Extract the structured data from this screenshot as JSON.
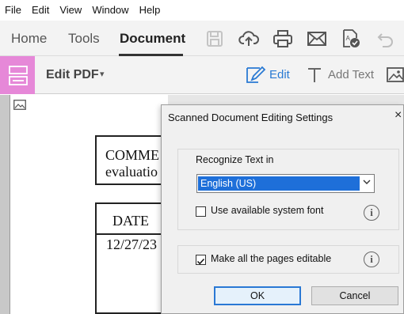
{
  "menubar": {
    "items": [
      "File",
      "Edit",
      "View",
      "Window",
      "Help"
    ]
  },
  "tabs": {
    "home": "Home",
    "tools": "Tools",
    "document": "Document"
  },
  "toolbar_icons": [
    "save-icon",
    "upload-cloud-icon",
    "print-icon",
    "mail-icon",
    "fill-sign-icon",
    "undo-icon"
  ],
  "edit_toolbar": {
    "title": "Edit PDF",
    "caret": "▾",
    "edit_label": "Edit",
    "add_text_label": "Add Text",
    "accent_color": "#e688d8",
    "link_color": "#2a7ad3"
  },
  "document": {
    "comment_line1": "COMME",
    "comment_line2": "evaluatio",
    "date_header": "DATE",
    "date_value": "12/27/23"
  },
  "dialog": {
    "title": "Scanned Document Editing Settings",
    "close": "×",
    "recognize_label": "Recognize Text in",
    "language": "English (US)",
    "system_font_label": "Use available system font",
    "system_font_checked": false,
    "editable_label": "Make all the pages editable",
    "editable_checked": true,
    "ok": "OK",
    "cancel": "Cancel",
    "info_glyph": "i"
  }
}
